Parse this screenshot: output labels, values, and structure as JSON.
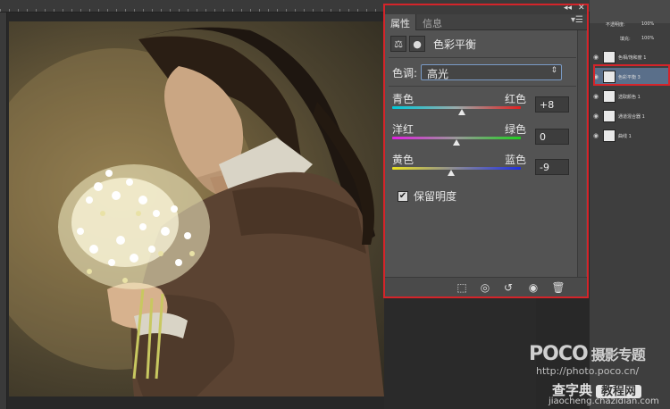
{
  "properties_panel": {
    "tabs": [
      {
        "label": "属性"
      },
      {
        "label": "信息"
      }
    ],
    "adjustment_title": "色彩平衡",
    "tone": {
      "label": "色调:",
      "value": "高光"
    },
    "sliders": [
      {
        "left": "青色",
        "right": "红色",
        "value": "+8",
        "level": 8
      },
      {
        "left": "洋红",
        "right": "绿色",
        "value": "0",
        "level": 0
      },
      {
        "left": "黄色",
        "right": "蓝色",
        "value": "-9",
        "level": -9
      }
    ],
    "preserve_luminosity": {
      "label": "保留明度",
      "checked": true
    }
  },
  "layers_panel": {
    "opacity_label": "不透明度:",
    "opacity_value": "100%",
    "fill_label": "填充:",
    "fill_value": "100%",
    "layers": [
      {
        "name": "色相/饱和度 1"
      },
      {
        "name": "色彩平衡 3",
        "selected": true
      },
      {
        "name": "选取颜色 1"
      },
      {
        "name": "通道混合器 1"
      },
      {
        "name": "曲线 1"
      }
    ]
  },
  "watermarks": {
    "poco": "POCO",
    "poco_sub": "摄影专题",
    "poco_url": "http://photo.poco.cn/",
    "chazidian": "查字典",
    "chazidian_box": "教程网",
    "chazidian_url": "jiaocheng.chazidian.com"
  },
  "colors": {
    "highlight_border": "#d4242a",
    "panel_bg": "#535353"
  }
}
